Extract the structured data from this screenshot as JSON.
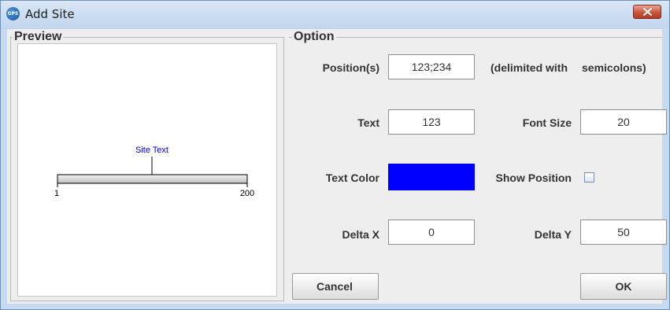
{
  "window": {
    "title": "Add Site",
    "icon_text": "GPS"
  },
  "preview": {
    "legend": "Preview",
    "site_text": "Site Text",
    "axis_start": "1",
    "axis_end": "200",
    "site_text_color": "#0000ff"
  },
  "option": {
    "legend": "Option",
    "position_label": "Position(s)",
    "position_value": "123;234",
    "position_hint_1": "(delimited with",
    "position_hint_2": "semicolons)",
    "text_label": "Text",
    "text_value": "123",
    "font_size_label": "Font Size",
    "font_size_value": "20",
    "text_color_label": "Text Color",
    "text_color_value": "#0000ff",
    "show_position_label": "Show Position",
    "show_position_checked": false,
    "delta_x_label": "Delta X",
    "delta_x_value": "0",
    "delta_y_label": "Delta Y",
    "delta_y_value": "50"
  },
  "buttons": {
    "cancel": "Cancel",
    "ok": "OK"
  }
}
